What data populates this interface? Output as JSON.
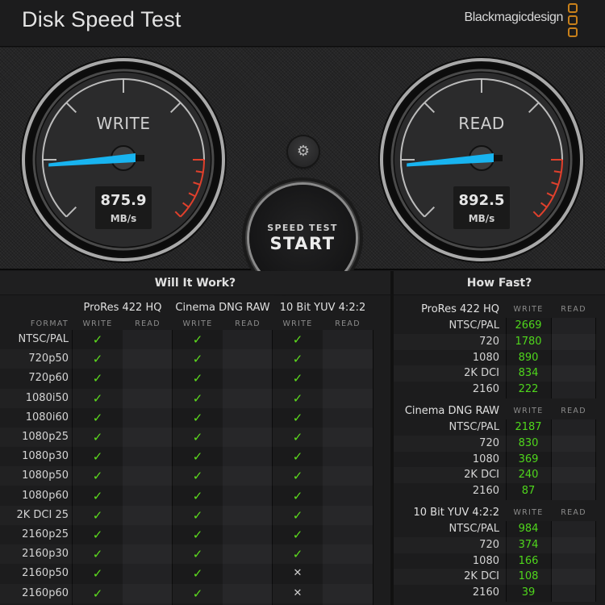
{
  "header": {
    "title": "Disk Speed Test",
    "brand": "Blackmagicdesign"
  },
  "gauges": {
    "write": {
      "label": "WRITE",
      "value": "875.9",
      "unit": "MB/s"
    },
    "read": {
      "label": "READ",
      "value": "892.5",
      "unit": "MB/s"
    }
  },
  "controls": {
    "settings_icon": "gear-icon",
    "start_sub": "SPEED TEST",
    "start_main": "START"
  },
  "will_it_work": {
    "title": "Will It Work?",
    "format_label": "FORMAT",
    "write_label": "WRITE",
    "read_label": "READ",
    "codecs": [
      "ProRes 422 HQ",
      "Cinema DNG RAW",
      "10 Bit YUV 4:2:2"
    ],
    "check_glyph": "✓",
    "cross_glyph": "✕",
    "rows": [
      {
        "format": "NTSC/PAL",
        "write": [
          "ok",
          "ok",
          "ok"
        ]
      },
      {
        "format": "720p50",
        "write": [
          "ok",
          "ok",
          "ok"
        ]
      },
      {
        "format": "720p60",
        "write": [
          "ok",
          "ok",
          "ok"
        ]
      },
      {
        "format": "1080i50",
        "write": [
          "ok",
          "ok",
          "ok"
        ]
      },
      {
        "format": "1080i60",
        "write": [
          "ok",
          "ok",
          "ok"
        ]
      },
      {
        "format": "1080p25",
        "write": [
          "ok",
          "ok",
          "ok"
        ]
      },
      {
        "format": "1080p30",
        "write": [
          "ok",
          "ok",
          "ok"
        ]
      },
      {
        "format": "1080p50",
        "write": [
          "ok",
          "ok",
          "ok"
        ]
      },
      {
        "format": "1080p60",
        "write": [
          "ok",
          "ok",
          "ok"
        ]
      },
      {
        "format": "2K DCI 25",
        "write": [
          "ok",
          "ok",
          "ok"
        ]
      },
      {
        "format": "2160p25",
        "write": [
          "ok",
          "ok",
          "ok"
        ]
      },
      {
        "format": "2160p30",
        "write": [
          "ok",
          "ok",
          "ok"
        ]
      },
      {
        "format": "2160p50",
        "write": [
          "ok",
          "ok",
          "no"
        ]
      },
      {
        "format": "2160p60",
        "write": [
          "ok",
          "ok",
          "no"
        ]
      }
    ]
  },
  "how_fast": {
    "title": "How Fast?",
    "write_label": "WRITE",
    "read_label": "READ",
    "sections": [
      {
        "codec": "ProRes 422 HQ",
        "rows": [
          {
            "res": "NTSC/PAL",
            "write": "2669",
            "read": ""
          },
          {
            "res": "720",
            "write": "1780",
            "read": ""
          },
          {
            "res": "1080",
            "write": "890",
            "read": ""
          },
          {
            "res": "2K DCI",
            "write": "834",
            "read": ""
          },
          {
            "res": "2160",
            "write": "222",
            "read": ""
          }
        ]
      },
      {
        "codec": "Cinema DNG RAW",
        "rows": [
          {
            "res": "NTSC/PAL",
            "write": "2187",
            "read": ""
          },
          {
            "res": "720",
            "write": "830",
            "read": ""
          },
          {
            "res": "1080",
            "write": "369",
            "read": ""
          },
          {
            "res": "2K DCI",
            "write": "240",
            "read": ""
          },
          {
            "res": "2160",
            "write": "87",
            "read": ""
          }
        ]
      },
      {
        "codec": "10 Bit YUV 4:2:2",
        "rows": [
          {
            "res": "NTSC/PAL",
            "write": "984",
            "read": ""
          },
          {
            "res": "720",
            "write": "374",
            "read": ""
          },
          {
            "res": "1080",
            "write": "166",
            "read": ""
          },
          {
            "res": "2K DCI",
            "write": "108",
            "read": ""
          },
          {
            "res": "2160",
            "write": "39",
            "read": ""
          }
        ]
      }
    ]
  },
  "colors": {
    "accent_needle": "#18b4f0",
    "redline": "#e0402c",
    "ok_green": "#5ddc1e",
    "logo_orange": "#c8801a"
  }
}
